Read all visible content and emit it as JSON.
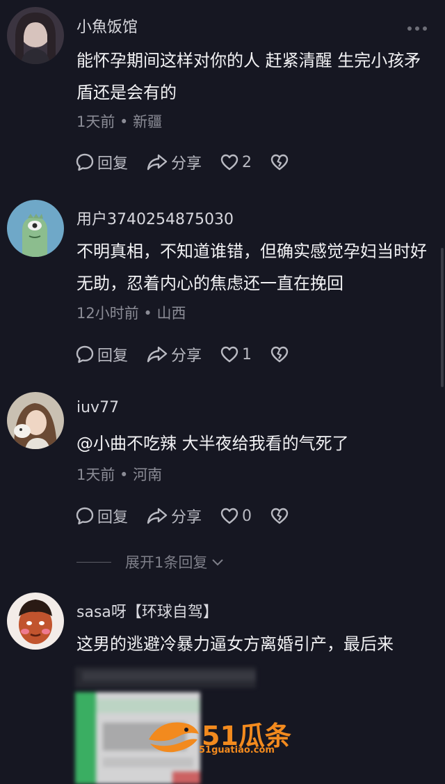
{
  "comments": [
    {
      "username": "小魚饭馆",
      "text": "能怀孕期间这样对你的人 赶紧清醒 生完小孩矛盾还是会有的",
      "meta": "1天前 • 新疆",
      "reply_label": "回复",
      "share_label": "分享",
      "likes": "2"
    },
    {
      "username": "用户3740254875030",
      "text": "不明真相，不知道谁错，但确实感觉孕妇当时好无助，忍着内心的焦虑还一直在挽回",
      "meta": "12小时前 • 山西",
      "reply_label": "回复",
      "share_label": "分享",
      "likes": "1"
    },
    {
      "username": "iuv77",
      "text": "@小曲不吃辣 大半夜给我看的气死了",
      "meta": "1天前 • 河南",
      "reply_label": "回复",
      "share_label": "分享",
      "likes": "0"
    },
    {
      "username": "sasa呀【环球自驾】",
      "text": "这男的逃避冷暴力逼女方离婚引产，最后来"
    }
  ],
  "expand_replies": "展开1条回复",
  "watermark": {
    "brand": "51瓜条",
    "url": "51guatiao.com"
  },
  "colors": {
    "background": "#161722",
    "accent_orange": "#f28a1e"
  }
}
